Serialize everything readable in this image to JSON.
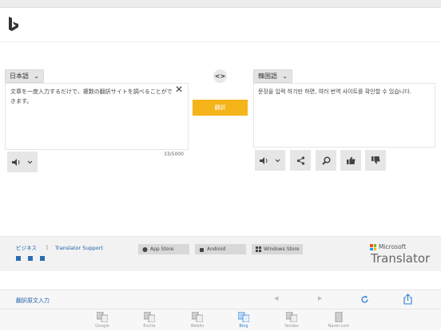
{
  "translator": {
    "source_lang": "日本語",
    "target_lang": "韓国語",
    "source_text": "文章を一度入力するだけで、複数の翻訳サイトを調べることができます。",
    "target_text": "문장을 입력 하기만 하면, 여러 번역 사이트를 확인할 수 있습니다.",
    "char_count": "33/5000",
    "translate_label": "翻訳",
    "swap_label": "<>"
  },
  "footer": {
    "business_link": "ビジネス",
    "separator": "|",
    "support_link": "Translator Support",
    "stores": [
      "App Store",
      "Android",
      "Windows Store"
    ],
    "ms_label": "Microsoft",
    "ms_product": "Translator"
  },
  "toolbar": {
    "edit_source_link": "翻訳原文入力"
  },
  "tabs": [
    {
      "label": "Google",
      "active": false
    },
    {
      "label": "Excite",
      "active": false
    },
    {
      "label": "Weblio",
      "active": false
    },
    {
      "label": "Bing",
      "active": true
    },
    {
      "label": "Yandex",
      "active": false
    },
    {
      "label": "Naver.com",
      "active": false
    }
  ],
  "colors": {
    "accent_yellow": "#f4b41a",
    "link_blue": "#1d5fa8",
    "active_tab_blue": "#2f7fd8"
  }
}
